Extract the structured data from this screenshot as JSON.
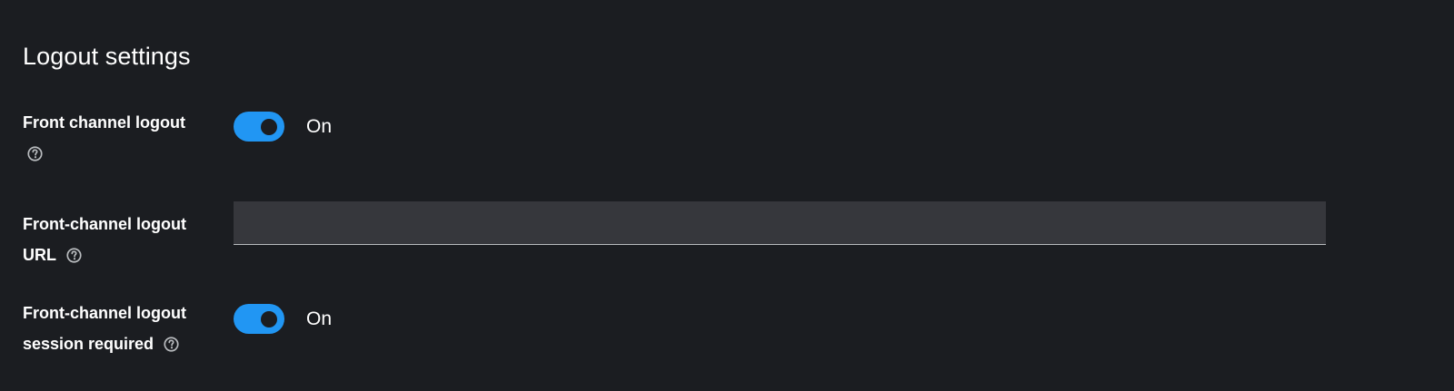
{
  "section": {
    "title": "Logout settings"
  },
  "fields": {
    "front_channel_logout": {
      "label": "Front channel logout",
      "toggle_state": "On"
    },
    "front_channel_logout_url": {
      "label_line1": "Front-channel logout",
      "label_line2": "URL",
      "value": "",
      "placeholder": ""
    },
    "front_channel_logout_session_required": {
      "label_line1": "Front-channel logout",
      "label_line2": "session required",
      "toggle_state": "On"
    }
  },
  "colors": {
    "background": "#1b1d21",
    "toggle_on": "#2196f3",
    "input_background": "#36373c",
    "help_icon": "#b8bbbe"
  },
  "icons": {
    "help": "help-circle-icon"
  }
}
